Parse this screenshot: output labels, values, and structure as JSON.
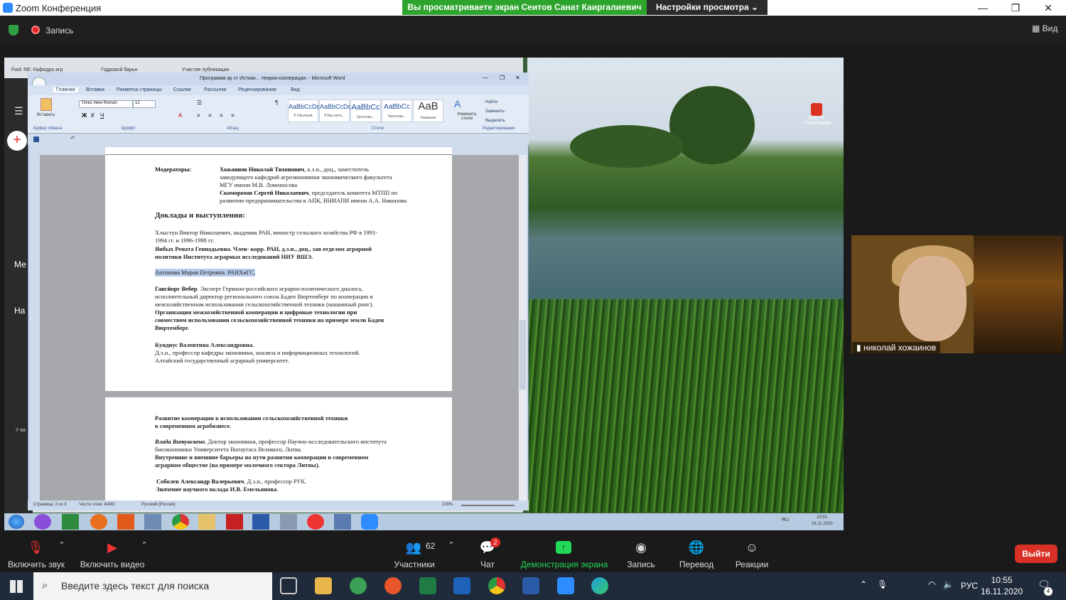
{
  "zoom": {
    "window_title": "Zoom Конференция",
    "viewing_banner": "Вы просматриваете экран Сеитов Санат Каиргалиевич",
    "view_options": "Настройки просмотра",
    "recording": "Запись",
    "view_button": "Вид",
    "participant_name": "николай хожаинов",
    "toolbar": {
      "mute": "Включить звук",
      "video": "Включить видео",
      "participants": "Участники",
      "participants_count": "62",
      "chat": "Чат",
      "chat_badge": "2",
      "share": "Демонстрация экрана",
      "record": "Запись",
      "translate": "Перевод",
      "reactions": "Реакции",
      "leave": "Выйти"
    }
  },
  "browser": {
    "tabs": [
      "Fwd: RE: Кафедра агр",
      "Годровой барьн",
      "Участие публикации"
    ]
  },
  "word": {
    "title": "Программа кр ст Истоки... теории кооперации. - Microsoft Word",
    "tabs": [
      "Главная",
      "Вставка",
      "Разметка страницы",
      "Ссылки",
      "Рассылки",
      "Рецензирование",
      "Вид"
    ],
    "font_name": "Times New Roman",
    "font_size": "12",
    "paste": "Вставить",
    "groups": [
      "Буфер обмена",
      "Шрифт",
      "Абзац",
      "Стили",
      "Редактирование"
    ],
    "styles": [
      {
        "preview": "AaBbCcDc",
        "name": "¶ Обычный"
      },
      {
        "preview": "AaBbCcDc",
        "name": "¶ Без инте..."
      },
      {
        "preview": "AaBbCc",
        "name": "Заголово..."
      },
      {
        "preview": "AaBbCc",
        "name": "Заголово..."
      },
      {
        "preview": "AaB",
        "name": "Название"
      }
    ],
    "change_styles": "Изменить стили",
    "editing": [
      "Найти",
      "Заменить",
      "Выделить"
    ],
    "status": {
      "page": "Страница: 2 из 3",
      "words": "Число слов: 4/483",
      "lang": "Русский (Россия)",
      "zoom": "100%"
    },
    "page1": {
      "moderators_label": "Модераторы:",
      "mod1_name": "Хожаинов Николай Тихонович",
      "mod1_rest": ", к.э.н., доц., заместитель",
      "mod1_line2": "заведующего кафедрой агроэкономики экономического факультета",
      "mod1_line3": "МГУ имени М.В. Ломоносова",
      "mod2_name": "Скоморохов Сергей Николаевич",
      "mod2_rest": ", председатель комитета МТПП по",
      "mod2_line2": "развитию предпринимательства в АПК, ВНИАПИ имени А.А. Никонова",
      "heading": "Доклады и выступления:",
      "p1_l1": "Хлыстун Виктор Николаевич, академик РАН, министр сельского хозяйства РФ в 1991-",
      "p1_l2": "1994 гг. и 1996-1998 гг.",
      "p2_l1": "Янбых Рената Геннадьевна. Член- корр. РАН, д.э.н., доц., зав отделом аграрной",
      "p2_l2": "политики Института аграрных исследований НИУ ВШЭ.",
      "p3": "Антонова Мария Петровна. РАНХиГС.",
      "p4_name": "Гансйорг Вебер",
      "p4_l1": ". Эксперт Германо-российского аграрно-политического диалога,",
      "p4_l2": "исполнительный директор регионального союза Баден Вюртемберг по кооперации в",
      "p4_l3": "межхозяйственном использовании сельскохозяйственной техники (машинный ринг).",
      "p4_l4": "Организация межхозяйственной кооперации и цифровые технологии при",
      "p4_l5": "совместном использовании сельскохозяйственной техники на примере земли Баден",
      "p4_l6": "Вюртемберг.",
      "p5_l1": "Кундиус Валентина Александровна.",
      "p5_l2": "Д.э.н., профессор кафедры экономики, анализа и информационных технологий.",
      "p5_l3": "Алтайский государственный аграрный университет."
    },
    "page2": {
      "h_l1": "Развитие кооперации в использовании сельскохозяйственной техники",
      "h_l2": "в современном агробизнесе.",
      "p1_name": "Влада Витунскене.",
      "p1_l1": " Доктор экономики, профессор Научно-исследовательского института",
      "p1_l2": "биоэкономики Университета Витаутаса Великого, Литва.",
      "p1_l3": "Внутренние и внешние барьеры на пути развития кооперации в современном",
      "p1_l4": "аграрном обществе (на примере молочного сектора Литвы).",
      "p2_name": "Соболев Александр Валерьевич",
      "p2_rest": ". Д.э.н., профессор РУК.",
      "p2_l2": "Значение научного вклада И.В. Емельянова."
    }
  },
  "shared_desktop": {
    "icon_label": "ABBYY FineReader",
    "tray_lang": "RU",
    "time": "10:51",
    "date": "16.11.2020"
  },
  "browser_side": {
    "label1": "Ме",
    "label2": "На",
    "label3": "У ва"
  },
  "windows": {
    "search_placeholder": "Введите здесь текст для поиска",
    "lang": "РУС",
    "time": "10:55",
    "date": "16.11.2020",
    "notif_count": "4"
  }
}
